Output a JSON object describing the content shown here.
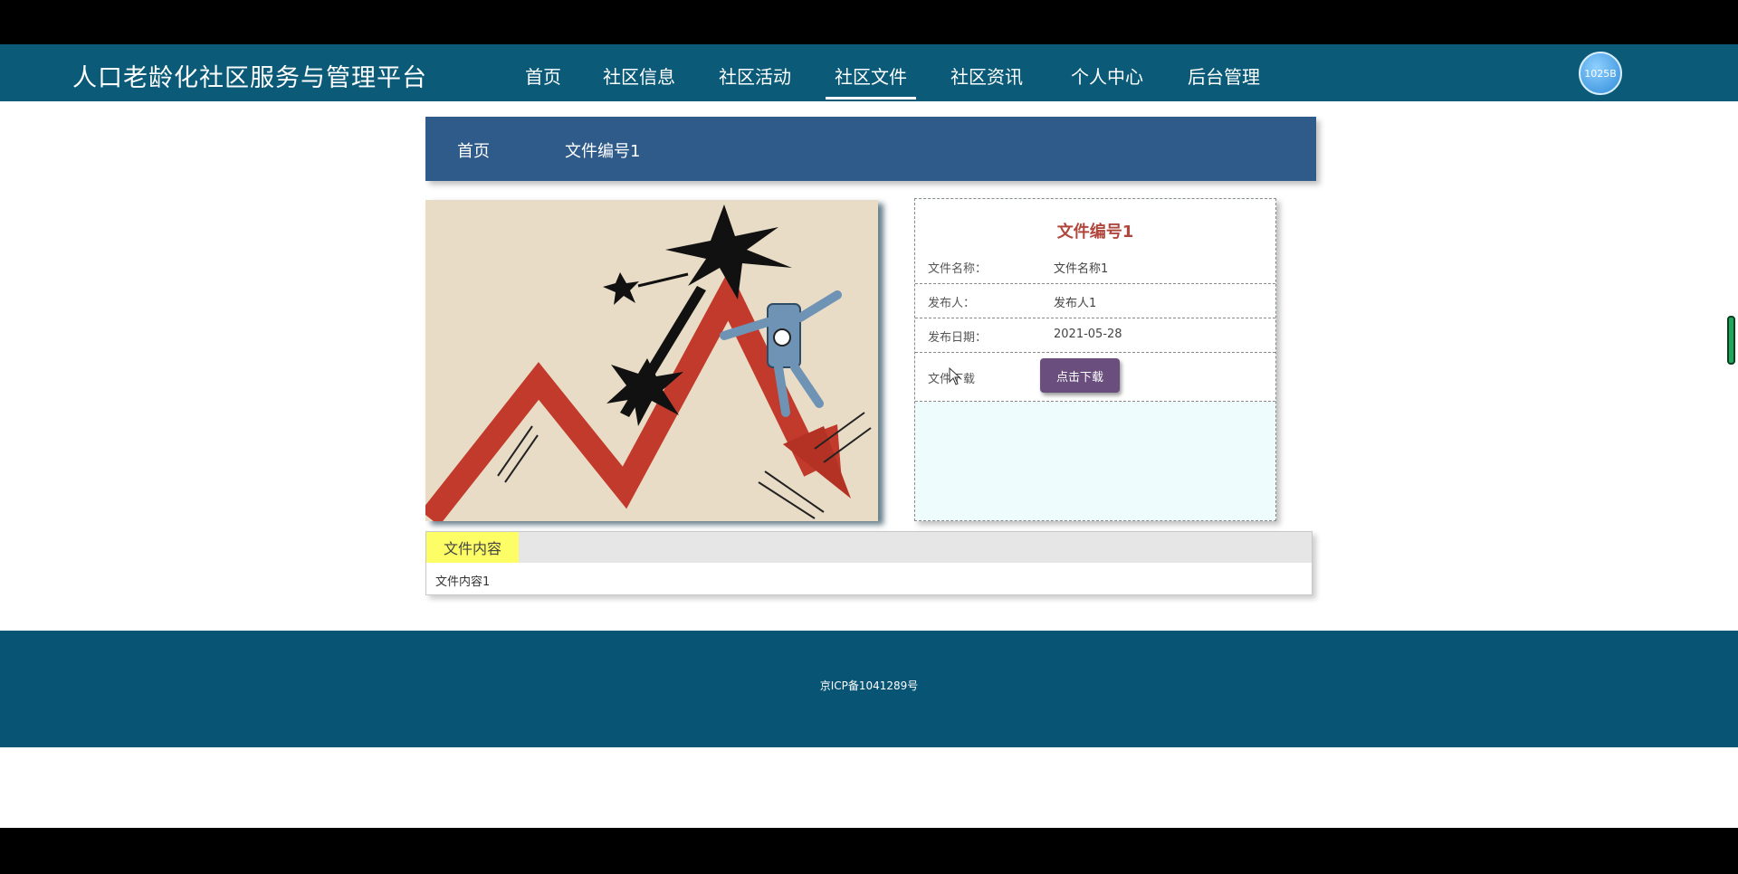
{
  "header": {
    "site_title": "人口老龄化社区服务与管理平台",
    "nav": [
      {
        "label": "首页"
      },
      {
        "label": "社区信息"
      },
      {
        "label": "社区活动"
      },
      {
        "label": "社区文件"
      },
      {
        "label": "社区资讯"
      },
      {
        "label": "个人中心"
      },
      {
        "label": "后台管理"
      }
    ],
    "active_nav": "社区文件",
    "avatar_text": "1025B"
  },
  "breadcrumb": {
    "home": "首页",
    "current": "文件编号1"
  },
  "file_card": {
    "title": "文件编号1",
    "rows": [
      {
        "label": "文件名称：",
        "value": "文件名称1"
      },
      {
        "label": "发布人：",
        "value": "发布人1"
      },
      {
        "label": "发布日期：",
        "value": "2021-05-28"
      }
    ],
    "download_label": "文件下载",
    "download_button": "点击下载"
  },
  "content": {
    "tab_label": "文件内容",
    "text": "文件内容1"
  },
  "footer": {
    "icp": "京ICP备1041289号"
  },
  "colors": {
    "header_bg": "#0a5a78",
    "breadcrumb_bg": "#2f5b8a",
    "title_red": "#b0473d",
    "button_purple": "#6a4f7e",
    "tab_yellow": "#fdfd66",
    "footer_bg": "#085475"
  }
}
